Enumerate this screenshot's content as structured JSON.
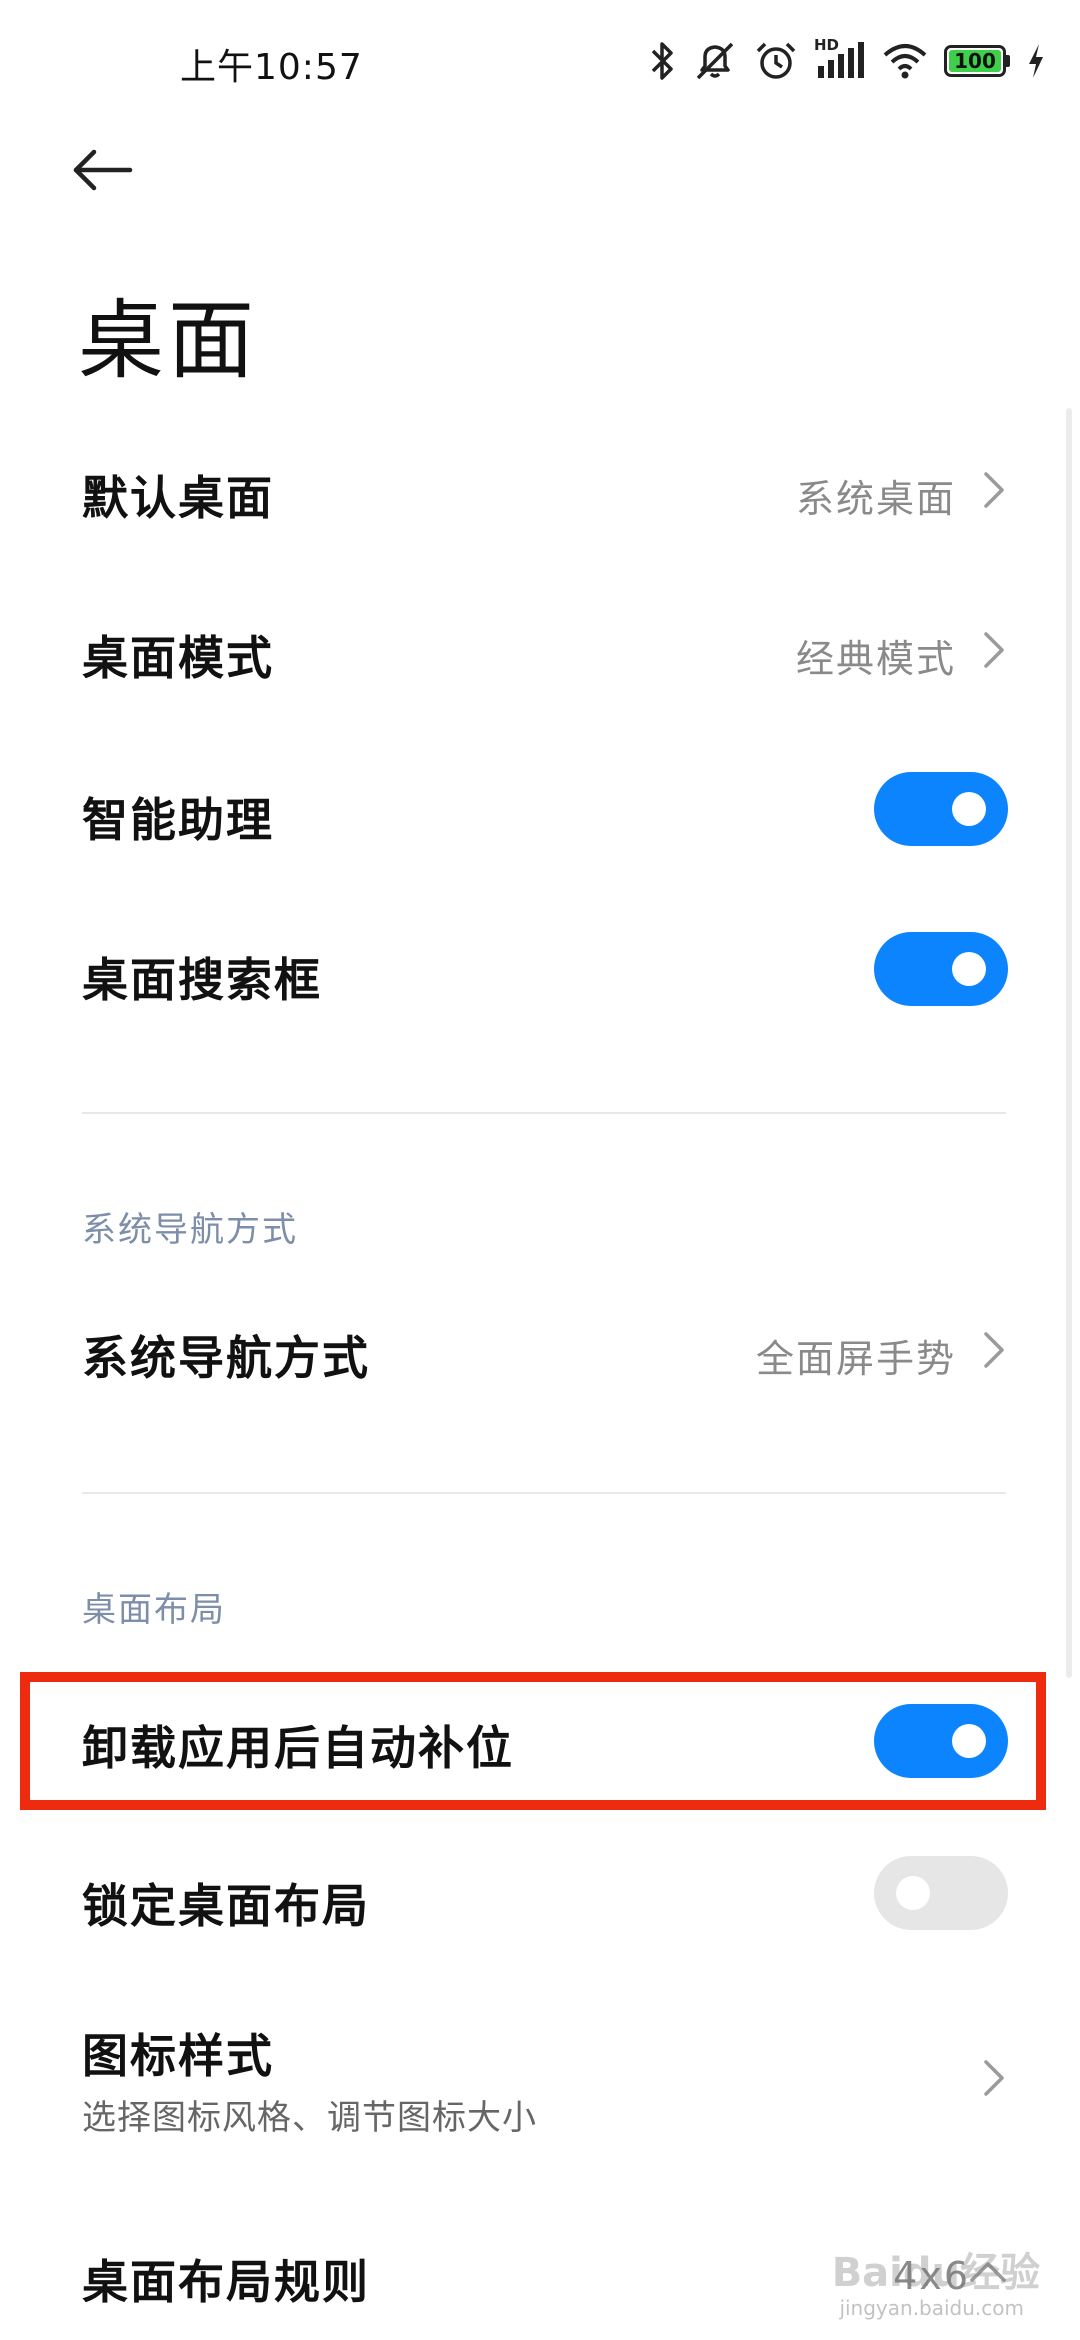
{
  "status_bar": {
    "time": "上午10:57",
    "network_label": "HD",
    "battery_level": "100",
    "icons": [
      "bluetooth-icon",
      "mute-icon",
      "alarm-icon",
      "signal-icon",
      "wifi-icon",
      "battery-icon",
      "charging-icon"
    ]
  },
  "header": {
    "title": "桌面"
  },
  "settings": {
    "default_launcher": {
      "label": "默认桌面",
      "value": "系统桌面"
    },
    "launcher_mode": {
      "label": "桌面模式",
      "value": "经典模式"
    },
    "smart_assistant": {
      "label": "智能助理",
      "enabled": true
    },
    "search_bar": {
      "label": "桌面搜索框",
      "enabled": true
    }
  },
  "navigation_section": {
    "header": "系统导航方式",
    "item": {
      "label": "系统导航方式",
      "value": "全面屏手势"
    }
  },
  "layout_section": {
    "header": "桌面布局",
    "auto_fill": {
      "label": "卸载应用后自动补位",
      "enabled": true
    },
    "lock_layout": {
      "label": "锁定桌面布局",
      "enabled": false
    },
    "icon_style": {
      "label": "图标样式",
      "description": "选择图标风格、调节图标大小"
    },
    "layout_rule": {
      "label": "桌面布局规则",
      "value": "4x6"
    }
  },
  "watermark": {
    "text": "Baidu经验",
    "sub": "jingyan.baidu.com"
  },
  "colors": {
    "accent": "#0c84fe",
    "toggle_off": "#e6e6e6",
    "highlight": "#ee2a0f",
    "section_header": "#7d8eaa",
    "battery": "#3fcf4a"
  }
}
